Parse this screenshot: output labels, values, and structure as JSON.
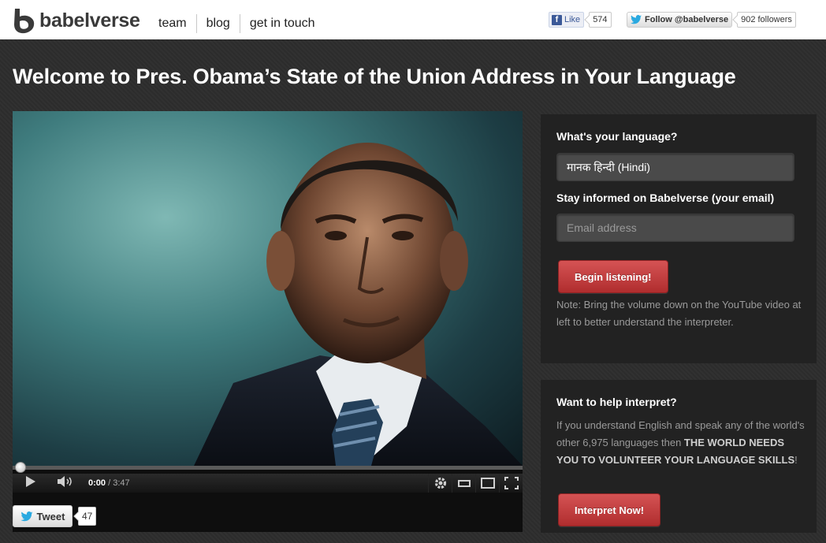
{
  "header": {
    "brand": "babelverse",
    "nav": [
      {
        "label": "team"
      },
      {
        "label": "blog"
      },
      {
        "label": "get in touch"
      }
    ],
    "facebook": {
      "label": "Like",
      "count": "574"
    },
    "twitter_follow": {
      "label": "Follow @babelverse",
      "count": "902 followers"
    }
  },
  "page_title": "Welcome to Pres. Obama’s State of the Union Address in Your Language",
  "video": {
    "current_time": "0:00",
    "duration": "/ 3:47",
    "progress": 0
  },
  "tweet": {
    "label": "Tweet",
    "count": "47"
  },
  "language_panel": {
    "language_label": "What's your language?",
    "language_value": "मानक हिन्दी (Hindi)",
    "email_label": "Stay informed on Babelverse (your email)",
    "email_placeholder": "Email address",
    "button": "Begin listening!",
    "note": "Note: Bring the volume down on the YouTube video at left to better understand the interpreter."
  },
  "interpret_panel": {
    "title": "Want to help interpret?",
    "text_plain": "If you understand English and speak any of the world's other 6,975 languages then ",
    "text_bold": "THE WORLD NEEDS YOU TO VOLUNTEER YOUR LANGUAGE SKILLS",
    "text_end": "!",
    "button": "Interpret Now!"
  },
  "colors": {
    "accent_red": "#c23b3c",
    "panel_bg": "#222222",
    "page_bg": "#2f2f2f"
  }
}
